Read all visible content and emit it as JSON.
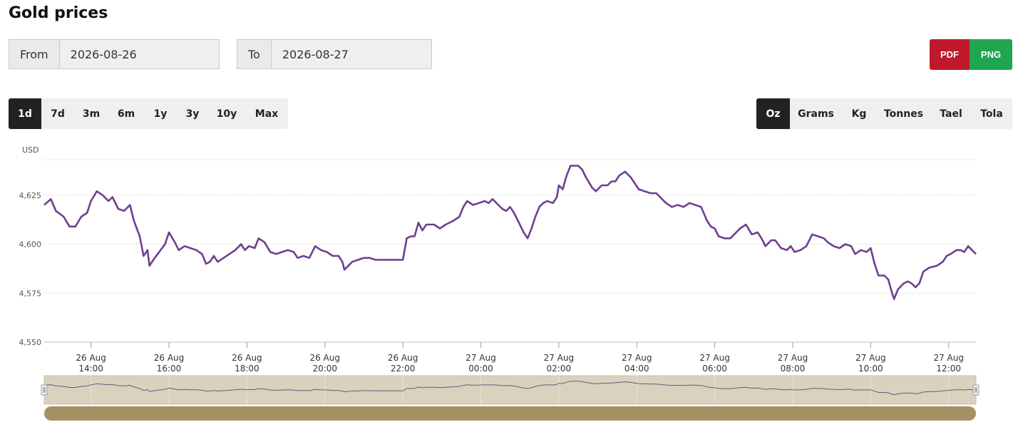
{
  "title": "Gold prices",
  "from": {
    "label": "From",
    "value": "2026-08-26"
  },
  "to": {
    "label": "To",
    "value": "2026-08-27"
  },
  "export": {
    "pdf_label": "PDF",
    "png_label": "PNG"
  },
  "ranges": [
    "1d",
    "7d",
    "3m",
    "6m",
    "1y",
    "3y",
    "10y",
    "Max"
  ],
  "active_range": "1d",
  "units": [
    "Oz",
    "Grams",
    "Kg",
    "Tonnes",
    "Tael",
    "Tola"
  ],
  "active_unit": "Oz",
  "colors": {
    "line": "#6e3f8e",
    "navigator_bg": "#d9d2bf",
    "navigator_line": "#6b5a7a",
    "scrollbar": "#a39163",
    "active_tab": "#222222",
    "pdf": "#c0192b",
    "png": "#1fa64e"
  },
  "chart_data": {
    "type": "line",
    "ylabel": "USD",
    "ylim": [
      4550,
      4650
    ],
    "yticks": [
      4550,
      4575,
      4600,
      4625
    ],
    "ytick_labels": [
      "4,550",
      "4,575",
      "4,600",
      "4,625"
    ],
    "x_start_hour": 12.8,
    "x_end_hour": 36.7,
    "xticks": [
      {
        "hour": 14,
        "date": "26 Aug",
        "time": "14:00"
      },
      {
        "hour": 16,
        "date": "26 Aug",
        "time": "16:00"
      },
      {
        "hour": 18,
        "date": "26 Aug",
        "time": "18:00"
      },
      {
        "hour": 20,
        "date": "26 Aug",
        "time": "20:00"
      },
      {
        "hour": 22,
        "date": "26 Aug",
        "time": "22:00"
      },
      {
        "hour": 24,
        "date": "27 Aug",
        "time": "00:00"
      },
      {
        "hour": 26,
        "date": "27 Aug",
        "time": "02:00"
      },
      {
        "hour": 28,
        "date": "27 Aug",
        "time": "04:00"
      },
      {
        "hour": 30,
        "date": "27 Aug",
        "time": "06:00"
      },
      {
        "hour": 32,
        "date": "27 Aug",
        "time": "08:00"
      },
      {
        "hour": 34,
        "date": "27 Aug",
        "time": "10:00"
      },
      {
        "hour": 36,
        "date": "27 Aug",
        "time": "12:00"
      }
    ],
    "grid": true,
    "series": [
      {
        "values": [
          [
            12.8,
            4620
          ],
          [
            12.97,
            4623
          ],
          [
            13.1,
            4617
          ],
          [
            13.3,
            4614
          ],
          [
            13.45,
            4609
          ],
          [
            13.6,
            4609
          ],
          [
            13.75,
            4614
          ],
          [
            13.9,
            4616
          ],
          [
            14.0,
            4622
          ],
          [
            14.15,
            4627
          ],
          [
            14.3,
            4625
          ],
          [
            14.45,
            4622
          ],
          [
            14.55,
            4624
          ],
          [
            14.7,
            4618
          ],
          [
            14.85,
            4617
          ],
          [
            15.0,
            4620
          ],
          [
            15.1,
            4612
          ],
          [
            15.25,
            4604
          ],
          [
            15.35,
            4594
          ],
          [
            15.45,
            4597
          ],
          [
            15.5,
            4589
          ],
          [
            15.6,
            4592
          ],
          [
            15.75,
            4596
          ],
          [
            15.9,
            4600
          ],
          [
            16.0,
            4606
          ],
          [
            16.15,
            4601
          ],
          [
            16.25,
            4597
          ],
          [
            16.4,
            4599
          ],
          [
            16.55,
            4598
          ],
          [
            16.7,
            4597
          ],
          [
            16.85,
            4595
          ],
          [
            16.95,
            4590
          ],
          [
            17.05,
            4591
          ],
          [
            17.15,
            4594
          ],
          [
            17.25,
            4591
          ],
          [
            17.4,
            4593
          ],
          [
            17.55,
            4595
          ],
          [
            17.7,
            4597
          ],
          [
            17.85,
            4600
          ],
          [
            17.95,
            4597
          ],
          [
            18.05,
            4599
          ],
          [
            18.2,
            4598
          ],
          [
            18.3,
            4603
          ],
          [
            18.45,
            4601
          ],
          [
            18.6,
            4596
          ],
          [
            18.75,
            4595
          ],
          [
            18.9,
            4596
          ],
          [
            19.05,
            4597
          ],
          [
            19.2,
            4596
          ],
          [
            19.3,
            4593
          ],
          [
            19.45,
            4594
          ],
          [
            19.6,
            4593
          ],
          [
            19.75,
            4599
          ],
          [
            19.9,
            4597
          ],
          [
            20.05,
            4596
          ],
          [
            20.2,
            4594
          ],
          [
            20.35,
            4594
          ],
          [
            20.45,
            4591
          ],
          [
            20.5,
            4587
          ],
          [
            20.7,
            4591
          ],
          [
            20.85,
            4592
          ],
          [
            21.0,
            4593
          ],
          [
            21.15,
            4593
          ],
          [
            21.3,
            4592
          ],
          [
            21.6,
            4592
          ],
          [
            22.0,
            4592
          ],
          [
            22.1,
            4603
          ],
          [
            22.2,
            4604
          ],
          [
            22.3,
            4604
          ],
          [
            22.4,
            4611
          ],
          [
            22.5,
            4607
          ],
          [
            22.6,
            4610
          ],
          [
            22.8,
            4610
          ],
          [
            22.95,
            4608
          ],
          [
            23.1,
            4610
          ],
          [
            23.3,
            4612
          ],
          [
            23.45,
            4614
          ],
          [
            23.55,
            4619
          ],
          [
            23.65,
            4622
          ],
          [
            23.8,
            4620
          ],
          [
            23.95,
            4621
          ],
          [
            24.1,
            4622
          ],
          [
            24.2,
            4621
          ],
          [
            24.3,
            4623
          ],
          [
            24.45,
            4620
          ],
          [
            24.55,
            4618
          ],
          [
            24.65,
            4617
          ],
          [
            24.75,
            4619
          ],
          [
            24.85,
            4616
          ],
          [
            25.0,
            4610
          ],
          [
            25.1,
            4606
          ],
          [
            25.2,
            4603
          ],
          [
            25.3,
            4608
          ],
          [
            25.4,
            4614
          ],
          [
            25.5,
            4619
          ],
          [
            25.6,
            4621
          ],
          [
            25.7,
            4622
          ],
          [
            25.85,
            4621
          ],
          [
            25.95,
            4624
          ],
          [
            26.0,
            4630
          ],
          [
            26.1,
            4628
          ],
          [
            26.2,
            4635
          ],
          [
            26.3,
            4640
          ],
          [
            26.4,
            4640
          ],
          [
            26.5,
            4640
          ],
          [
            26.6,
            4638
          ],
          [
            26.7,
            4634
          ],
          [
            26.85,
            4629
          ],
          [
            26.95,
            4627
          ],
          [
            27.1,
            4630
          ],
          [
            27.25,
            4630
          ],
          [
            27.35,
            4632
          ],
          [
            27.45,
            4632
          ],
          [
            27.55,
            4635
          ],
          [
            27.7,
            4637
          ],
          [
            27.85,
            4634
          ],
          [
            27.95,
            4631
          ],
          [
            28.05,
            4628
          ],
          [
            28.2,
            4627
          ],
          [
            28.35,
            4626
          ],
          [
            28.5,
            4626
          ],
          [
            28.6,
            4624
          ],
          [
            28.75,
            4621
          ],
          [
            28.9,
            4619
          ],
          [
            29.05,
            4620
          ],
          [
            29.2,
            4619
          ],
          [
            29.35,
            4621
          ],
          [
            29.5,
            4620
          ],
          [
            29.65,
            4619
          ],
          [
            29.8,
            4612
          ],
          [
            29.9,
            4609
          ],
          [
            30.0,
            4608
          ],
          [
            30.1,
            4604
          ],
          [
            30.25,
            4603
          ],
          [
            30.4,
            4603
          ],
          [
            30.55,
            4606
          ],
          [
            30.65,
            4608
          ],
          [
            30.8,
            4610
          ],
          [
            30.95,
            4605
          ],
          [
            31.1,
            4606
          ],
          [
            31.2,
            4603
          ],
          [
            31.3,
            4599
          ],
          [
            31.45,
            4602
          ],
          [
            31.55,
            4602
          ],
          [
            31.7,
            4598
          ],
          [
            31.85,
            4597
          ],
          [
            31.95,
            4599
          ],
          [
            32.05,
            4596
          ],
          [
            32.2,
            4597
          ],
          [
            32.35,
            4599
          ],
          [
            32.5,
            4605
          ],
          [
            32.65,
            4604
          ],
          [
            32.8,
            4603
          ],
          [
            32.9,
            4601
          ],
          [
            33.05,
            4599
          ],
          [
            33.2,
            4598
          ],
          [
            33.35,
            4600
          ],
          [
            33.5,
            4599
          ],
          [
            33.6,
            4595
          ],
          [
            33.75,
            4597
          ],
          [
            33.9,
            4596
          ],
          [
            34.0,
            4598
          ],
          [
            34.1,
            4590
          ],
          [
            34.2,
            4584
          ],
          [
            34.35,
            4584
          ],
          [
            34.45,
            4582
          ],
          [
            34.55,
            4575
          ],
          [
            34.6,
            4572
          ],
          [
            34.7,
            4577
          ],
          [
            34.85,
            4580
          ],
          [
            34.95,
            4581
          ],
          [
            35.05,
            4580
          ],
          [
            35.15,
            4578
          ],
          [
            35.25,
            4580
          ],
          [
            35.35,
            4586
          ],
          [
            35.5,
            4588
          ],
          [
            35.7,
            4589
          ],
          [
            35.85,
            4591
          ],
          [
            35.95,
            4594
          ],
          [
            36.05,
            4595
          ],
          [
            36.2,
            4597
          ],
          [
            36.3,
            4597
          ],
          [
            36.4,
            4596
          ],
          [
            36.5,
            4599
          ],
          [
            36.6,
            4597
          ],
          [
            36.7,
            4595
          ]
        ]
      }
    ]
  }
}
